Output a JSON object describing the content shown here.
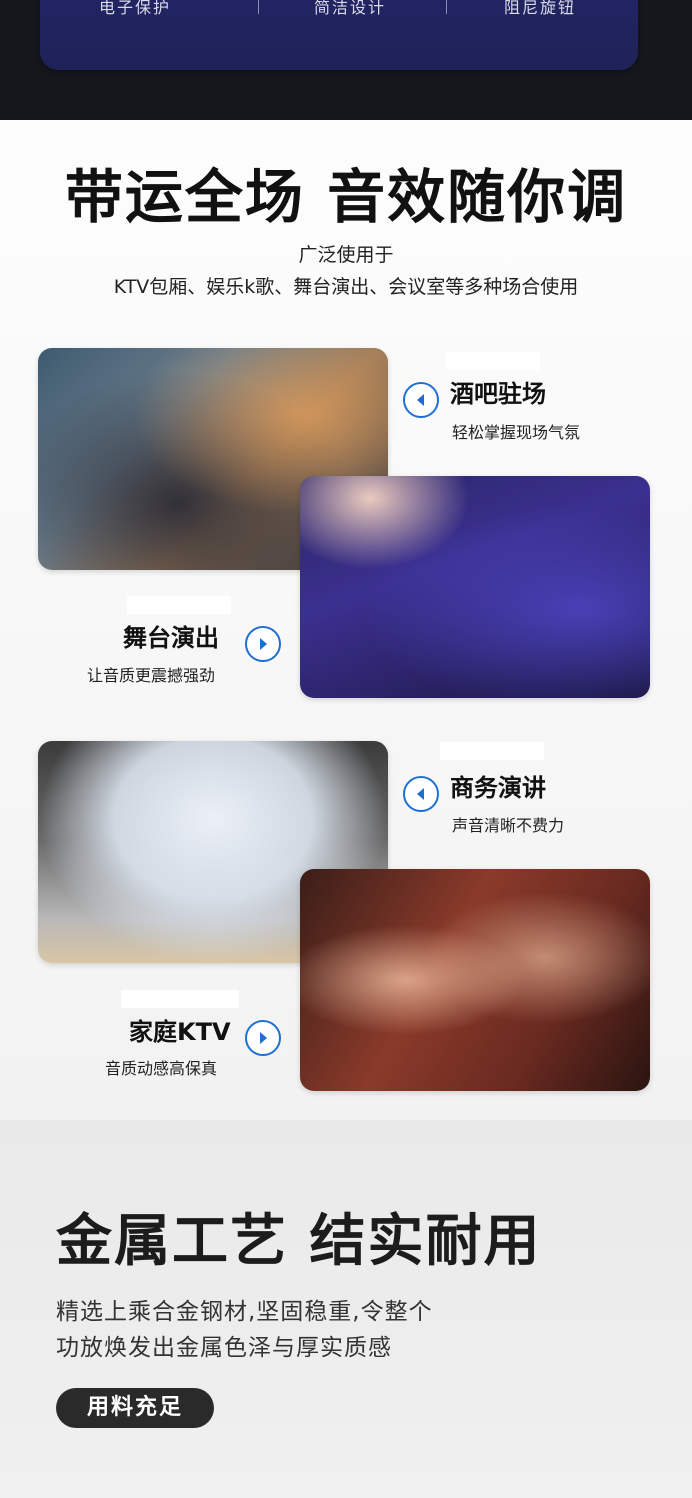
{
  "features": [
    "电子保护",
    "简洁设计",
    "阻尼旋钮"
  ],
  "hero": {
    "title": "带运全场 音效随你调",
    "subtitle": "广泛使用于",
    "description": "KTV包厢、娱乐k歌、舞台演出、会议室等多种场合使用"
  },
  "scenes": [
    {
      "title": "酒吧驻场",
      "subtitle": "轻松掌握现场气氛",
      "icon": "chevron-left-icon"
    },
    {
      "title": "舞台演出",
      "subtitle": "让音质更震撼强劲",
      "icon": "chevron-right-icon"
    },
    {
      "title": "商务演讲",
      "subtitle": "声音清晰不费力",
      "icon": "chevron-left-icon"
    },
    {
      "title": "家庭KTV",
      "subtitle": "音质动感高保真",
      "icon": "chevron-right-icon"
    }
  ],
  "metal": {
    "title": "金属工艺 结实耐用",
    "line1": "精选上乘合金钢材,坚固稳重,令整个",
    "line2": "功放焕发出金属色泽与厚实质感",
    "badge": "用料充足"
  },
  "colors": {
    "accent": "#1f6fd2",
    "feature_bar": "#222463",
    "dark": "#16171d"
  }
}
